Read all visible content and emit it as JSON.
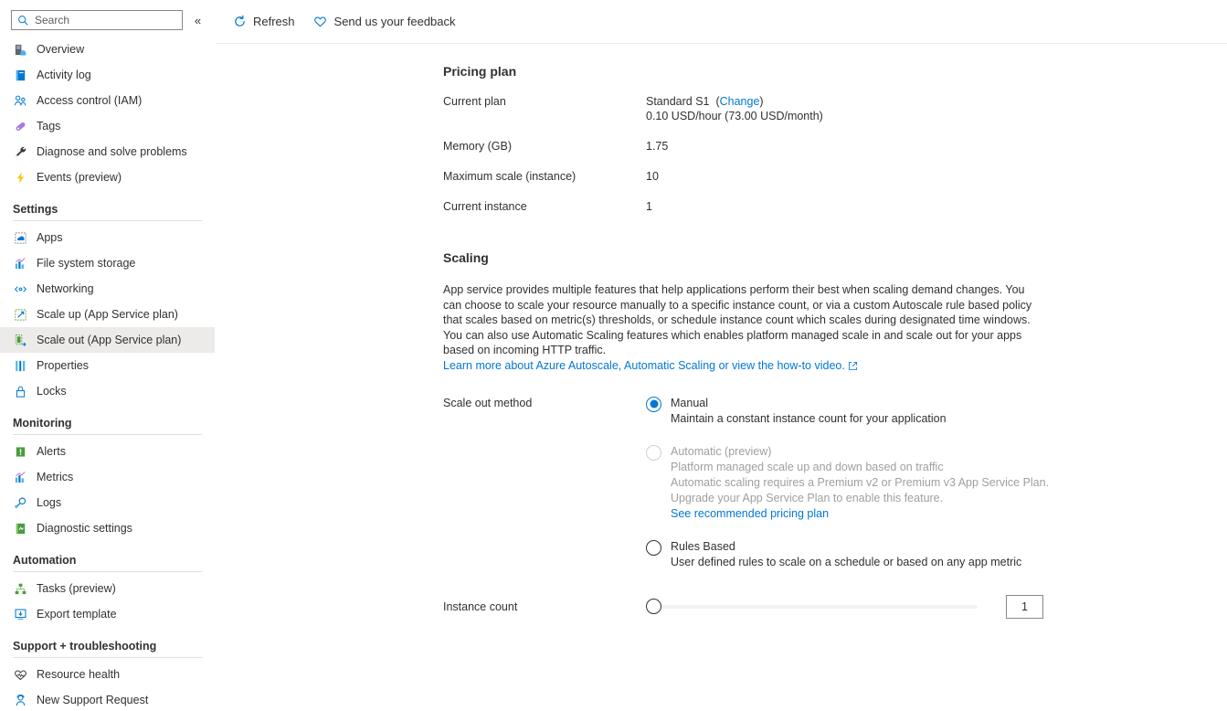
{
  "sidebar": {
    "search": {
      "placeholder": "Search",
      "value": ""
    },
    "collapse_label": "«",
    "top_items": [
      {
        "label": "Overview",
        "icon": "overview-icon"
      },
      {
        "label": "Activity log",
        "icon": "activity-log-icon"
      },
      {
        "label": "Access control (IAM)",
        "icon": "access-control-icon"
      },
      {
        "label": "Tags",
        "icon": "tags-icon"
      },
      {
        "label": "Diagnose and solve problems",
        "icon": "wrench-icon"
      },
      {
        "label": "Events (preview)",
        "icon": "lightning-icon"
      }
    ],
    "groups": [
      {
        "title": "Settings",
        "items": [
          {
            "label": "Apps",
            "icon": "apps-icon"
          },
          {
            "label": "File system storage",
            "icon": "chart-icon"
          },
          {
            "label": "Networking",
            "icon": "networking-icon"
          },
          {
            "label": "Scale up (App Service plan)",
            "icon": "scale-up-icon"
          },
          {
            "label": "Scale out (App Service plan)",
            "icon": "scale-out-icon",
            "selected": true
          },
          {
            "label": "Properties",
            "icon": "properties-icon"
          },
          {
            "label": "Locks",
            "icon": "lock-icon"
          }
        ]
      },
      {
        "title": "Monitoring",
        "items": [
          {
            "label": "Alerts",
            "icon": "alerts-icon"
          },
          {
            "label": "Metrics",
            "icon": "metrics-icon"
          },
          {
            "label": "Logs",
            "icon": "logs-icon"
          },
          {
            "label": "Diagnostic settings",
            "icon": "diagnostic-settings-icon"
          }
        ]
      },
      {
        "title": "Automation",
        "items": [
          {
            "label": "Tasks (preview)",
            "icon": "tasks-icon"
          },
          {
            "label": "Export template",
            "icon": "export-template-icon"
          }
        ]
      },
      {
        "title": "Support + troubleshooting",
        "items": [
          {
            "label": "Resource health",
            "icon": "heart-pulse-icon"
          },
          {
            "label": "New Support Request",
            "icon": "support-person-icon"
          }
        ]
      }
    ]
  },
  "toolbar": {
    "refresh_label": "Refresh",
    "feedback_label": "Send us your feedback"
  },
  "pricing_plan": {
    "heading": "Pricing plan",
    "rows": [
      {
        "label": "Current plan",
        "value": "Standard S1",
        "link": "Change",
        "value_line2": "0.10 USD/hour (73.00 USD/month)"
      },
      {
        "label": "Memory (GB)",
        "value": "1.75"
      },
      {
        "label": "Maximum scale (instance)",
        "value": "10"
      },
      {
        "label": "Current instance",
        "value": "1"
      }
    ]
  },
  "scaling": {
    "heading": "Scaling",
    "description": "App service provides multiple features that help applications perform their best when scaling demand changes. You can choose to scale your resource manually to a specific instance count, or via a custom Autoscale rule based policy that scales based on metric(s) thresholds, or schedule instance count which scales during designated time windows. You can also use Automatic Scaling features which enables platform managed scale in and scale out for your apps based on incoming HTTP traffic.",
    "learn_more_link": "Learn more about Azure Autoscale, Automatic Scaling or view the how-to video.",
    "method_label": "Scale out method",
    "options": [
      {
        "title": "Manual",
        "sub1": "Maintain a constant instance count for your application",
        "selected": true,
        "disabled": false
      },
      {
        "title": "Automatic (preview)",
        "sub1": "Platform managed scale up and down based on traffic",
        "sub2": "Automatic scaling requires a Premium v2 or Premium v3 App Service Plan.",
        "sub3": "Upgrade your App Service Plan to enable this feature.",
        "link": "See recommended pricing plan",
        "selected": false,
        "disabled": true
      },
      {
        "title": "Rules Based",
        "sub1": "User defined rules to scale on a schedule or based on any app metric",
        "selected": false,
        "disabled": false
      }
    ],
    "instance_count_label": "Instance count",
    "instance_count_value": "1"
  },
  "colors": {
    "accent": "#0078d4",
    "text": "#323130",
    "disabled_text": "#a19f9d",
    "selected_row_bg": "#edebe9"
  }
}
